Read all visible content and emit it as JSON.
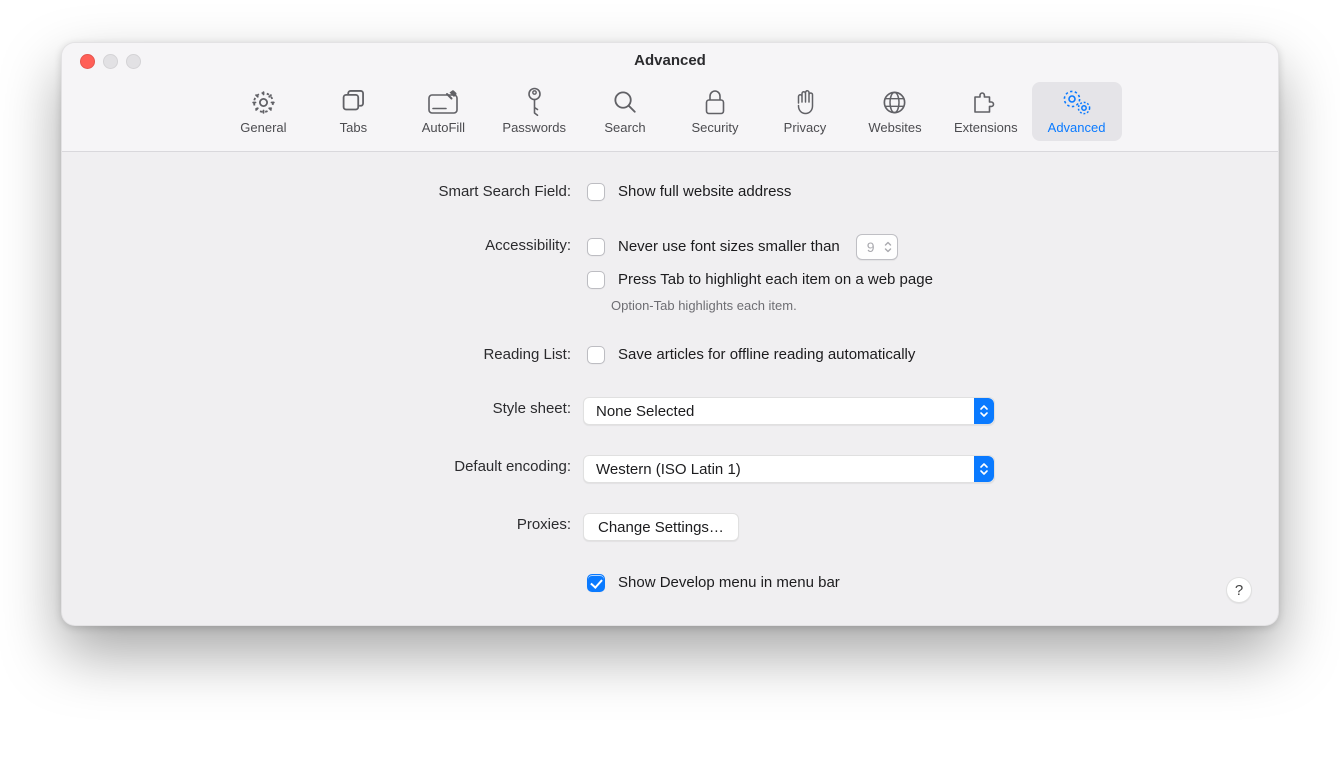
{
  "window": {
    "title": "Advanced"
  },
  "tabs": [
    {
      "id": "general",
      "label": "General",
      "selected": false
    },
    {
      "id": "tabs",
      "label": "Tabs",
      "selected": false
    },
    {
      "id": "autofill",
      "label": "AutoFill",
      "selected": false
    },
    {
      "id": "passwords",
      "label": "Passwords",
      "selected": false
    },
    {
      "id": "search",
      "label": "Search",
      "selected": false
    },
    {
      "id": "security",
      "label": "Security",
      "selected": false
    },
    {
      "id": "privacy",
      "label": "Privacy",
      "selected": false
    },
    {
      "id": "websites",
      "label": "Websites",
      "selected": false
    },
    {
      "id": "extensions",
      "label": "Extensions",
      "selected": false
    },
    {
      "id": "advanced",
      "label": "Advanced",
      "selected": true
    }
  ],
  "form": {
    "smart_search": {
      "label": "Smart Search Field:",
      "show_full_address": {
        "label": "Show full website address",
        "checked": false
      }
    },
    "accessibility": {
      "label": "Accessibility:",
      "min_font": {
        "label": "Never use font sizes smaller than",
        "checked": false,
        "value": "9"
      },
      "tab_highlight": {
        "label": "Press Tab to highlight each item on a web page",
        "checked": false,
        "hint": "Option-Tab highlights each item."
      }
    },
    "reading_list": {
      "label": "Reading List:",
      "offline": {
        "label": "Save articles for offline reading automatically",
        "checked": false
      }
    },
    "style_sheet": {
      "label": "Style sheet:",
      "value": "None Selected"
    },
    "encoding": {
      "label": "Default encoding:",
      "value": "Western (ISO Latin 1)"
    },
    "proxies": {
      "label": "Proxies:",
      "button": "Change Settings…"
    },
    "develop": {
      "label": "Show Develop menu in menu bar",
      "checked": true
    }
  },
  "help_label": "?"
}
